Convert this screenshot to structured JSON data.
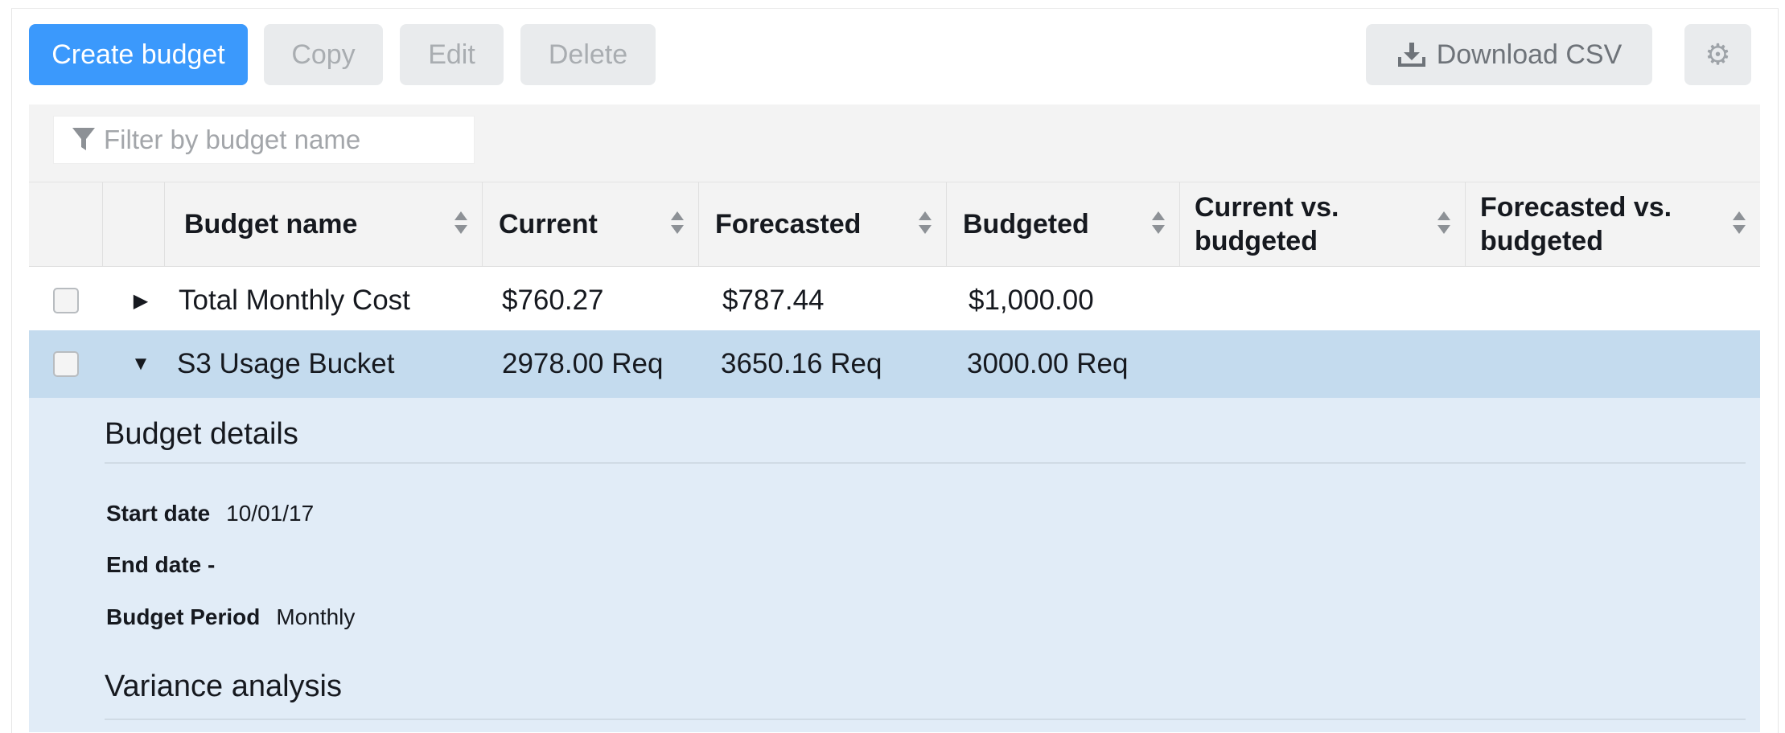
{
  "toolbar": {
    "create_label": "Create budget",
    "copy_label": "Copy",
    "edit_label": "Edit",
    "delete_label": "Delete",
    "download_label": "Download CSV"
  },
  "filter": {
    "placeholder": "Filter by budget name"
  },
  "table": {
    "columns": [
      {
        "label": "Budget name"
      },
      {
        "label": "Current"
      },
      {
        "label": "Forecasted"
      },
      {
        "label": "Budgeted"
      },
      {
        "label": "Current vs. budgeted"
      },
      {
        "label": "Forecasted vs. budgeted"
      }
    ],
    "rows": [
      {
        "name": "Total Monthly Cost",
        "current": "$760.27",
        "forecasted": "$787.44",
        "budgeted": "$1,000.00",
        "expanded": false
      },
      {
        "name": "S3 Usage Bucket",
        "current": "2978.00 Req",
        "forecasted": "3650.16 Req",
        "budgeted": "3000.00 Req",
        "expanded": true
      }
    ]
  },
  "details": {
    "title": "Budget details",
    "start_label": "Start date",
    "start_value": "10/01/17",
    "end_label": "End date -",
    "period_label": "Budget Period",
    "period_value": "Monthly",
    "variance_title": "Variance analysis"
  },
  "icons": {
    "filter": "filter-icon",
    "download": "download-icon",
    "settings": "gear-icon",
    "collapsed": "caret-right-icon",
    "expanded": "caret-down-icon"
  },
  "colors": {
    "primary": "#3b99fc",
    "selected_row": "#c4dbee",
    "details_bg": "#e1ecf7"
  }
}
